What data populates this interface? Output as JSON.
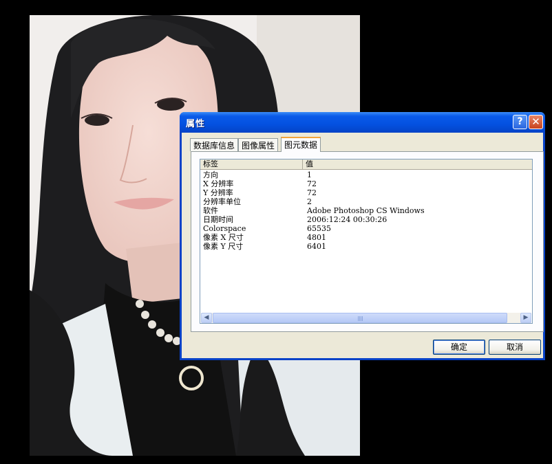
{
  "dialog": {
    "title": "属性",
    "help_label": "?",
    "close_label": "✕"
  },
  "tabs": [
    {
      "label": "数据库信息"
    },
    {
      "label": "图像属性"
    },
    {
      "label": "图元数据"
    }
  ],
  "table": {
    "columns": [
      "标签",
      "值"
    ],
    "rows": [
      {
        "label": "方向",
        "value": "1"
      },
      {
        "label": "X 分辨率",
        "value": "72"
      },
      {
        "label": "Y 分辨率",
        "value": "72"
      },
      {
        "label": "分辨率单位",
        "value": "2"
      },
      {
        "label": "软件",
        "value": "Adobe Photoshop CS Windows"
      },
      {
        "label": "日期时间",
        "value": "2006:12:24 00:30:26"
      },
      {
        "label": "Colorspace",
        "value": "65535"
      },
      {
        "label": "像素 X 尺寸",
        "value": "4801"
      },
      {
        "label": "像素 Y 尺寸",
        "value": "6401"
      }
    ]
  },
  "scrollbar": {
    "left_arrow": "◀",
    "right_arrow": "▶"
  },
  "buttons": {
    "ok": "确定",
    "cancel": "取消"
  },
  "colors": {
    "titlebar": "#0451e0",
    "dialog_bg": "#ece9d8",
    "active_tab_accent": "#f2a53b"
  }
}
